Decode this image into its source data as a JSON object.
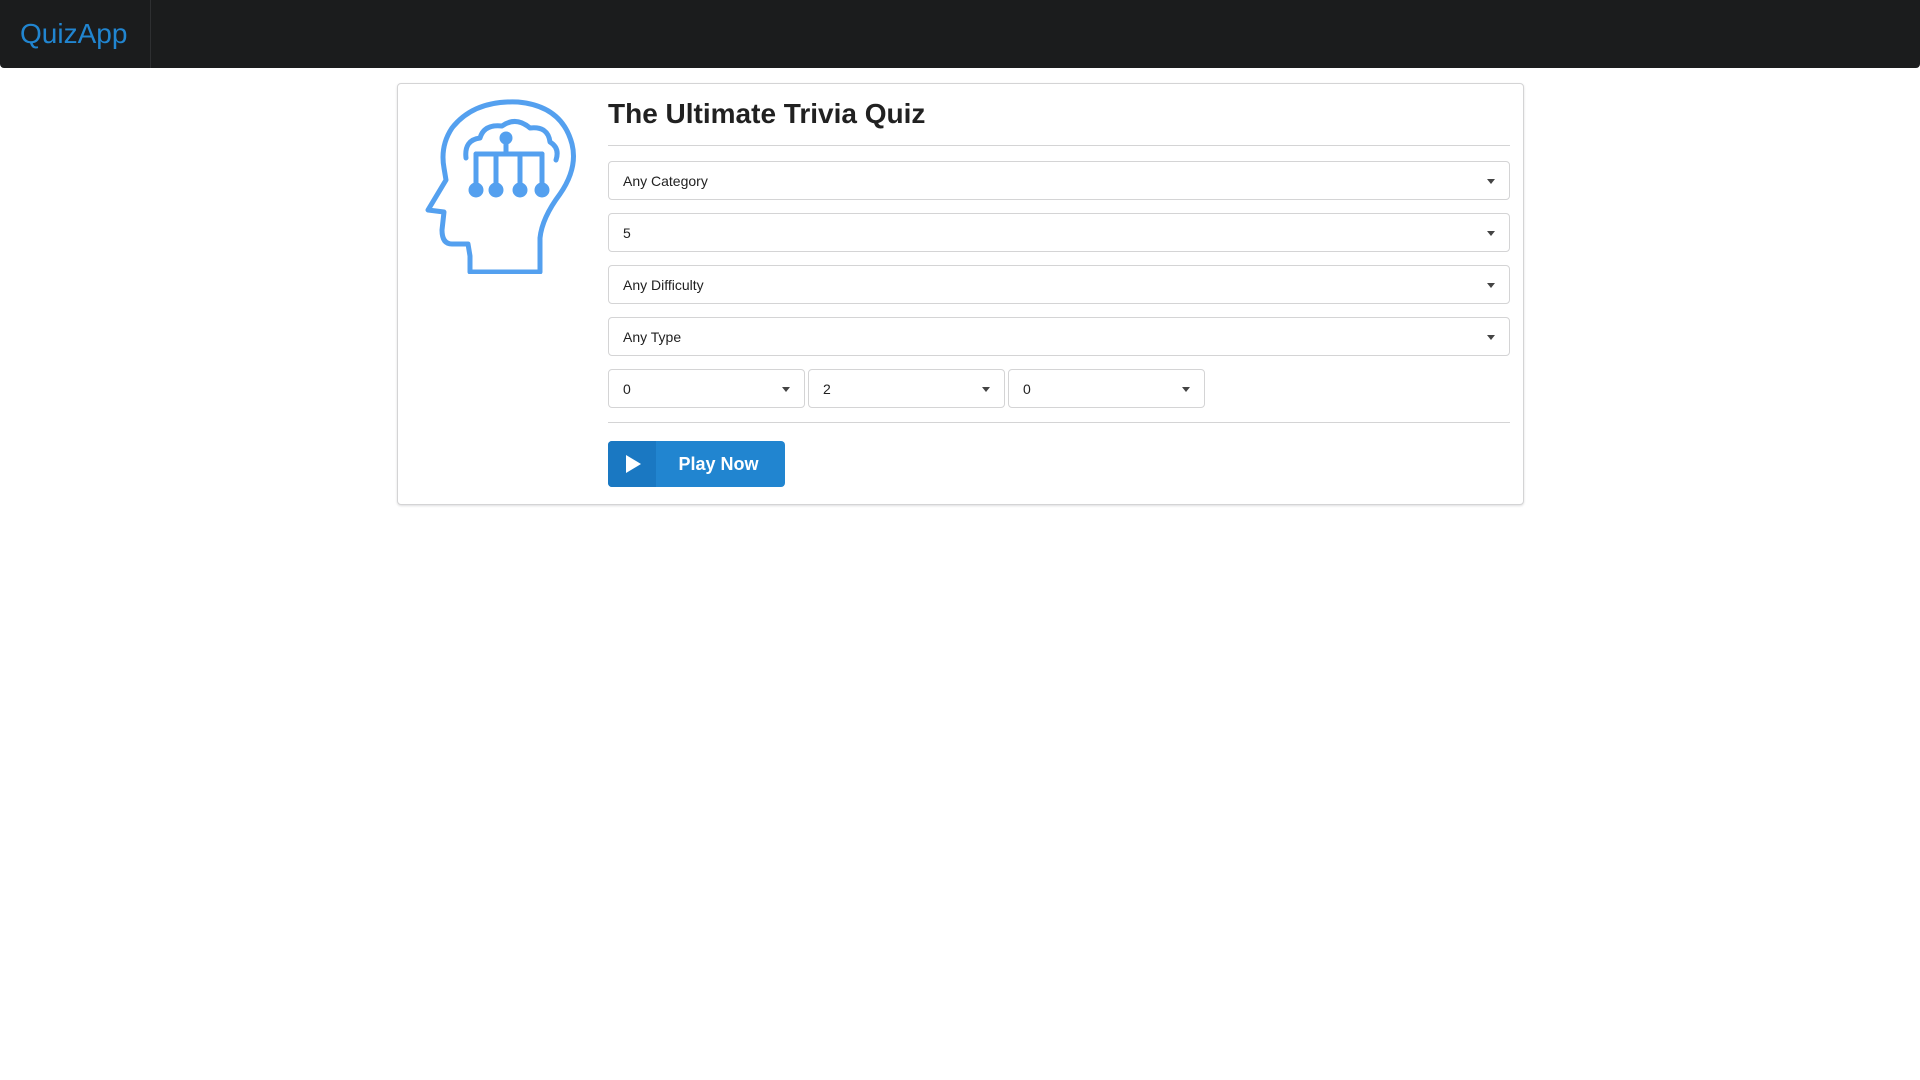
{
  "navbar": {
    "brand": "QuizApp",
    "brand_color": "#2185d0",
    "background": "#1b1c1d"
  },
  "quiz": {
    "illustration_icon": "brain-network-head-icon",
    "title": "The Ultimate Trivia Quiz",
    "category": {
      "selected": "Any Category"
    },
    "question_count": {
      "selected": "5"
    },
    "difficulty": {
      "selected": "Any Difficulty"
    },
    "type": {
      "selected": "Any Type"
    },
    "countdown": {
      "hours": "0",
      "minutes": "2",
      "seconds": "0"
    },
    "play_button": {
      "label": "Play Now",
      "icon": "play-icon",
      "color": "#2185d0"
    }
  }
}
